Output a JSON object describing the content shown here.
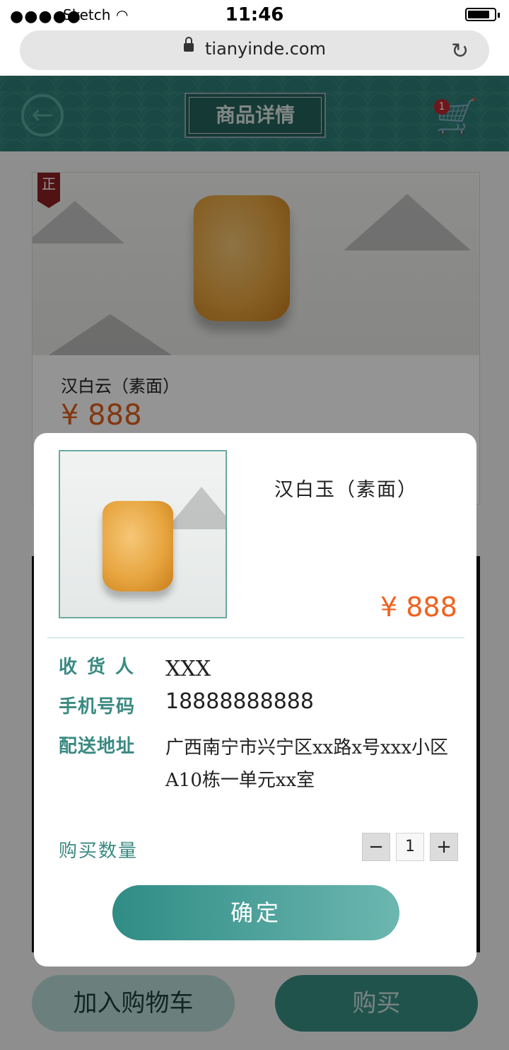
{
  "status": {
    "signal": "●●●●●",
    "carrier": "Sketch",
    "time": "11:46"
  },
  "browser": {
    "url": "tianyinde.com"
  },
  "header": {
    "title": "商品详情",
    "cart_badge": "1"
  },
  "product": {
    "badge": "正",
    "name": "汉白云（素面）",
    "price": "¥ 888"
  },
  "bottom": {
    "add_cart_label": "加入购物车",
    "buy_label": "购买"
  },
  "modal": {
    "name": "汉白玉（素面）",
    "price": "¥ 888",
    "receiver_label": "收货人",
    "receiver_value": "XXX",
    "phone_label": "手机号码",
    "phone_value": "18888888888",
    "address_label": "配送地址",
    "address_value": "广西南宁市兴宁区xx路x号xxx小区A10栋一单元xx室",
    "quantity_label": "购买数量",
    "quantity_value": "1",
    "minus": "−",
    "plus": "+",
    "confirm_label": "确定"
  },
  "colors": {
    "accent": "#3a8a82",
    "price": "#f0621f",
    "header": "#2d7f77"
  }
}
